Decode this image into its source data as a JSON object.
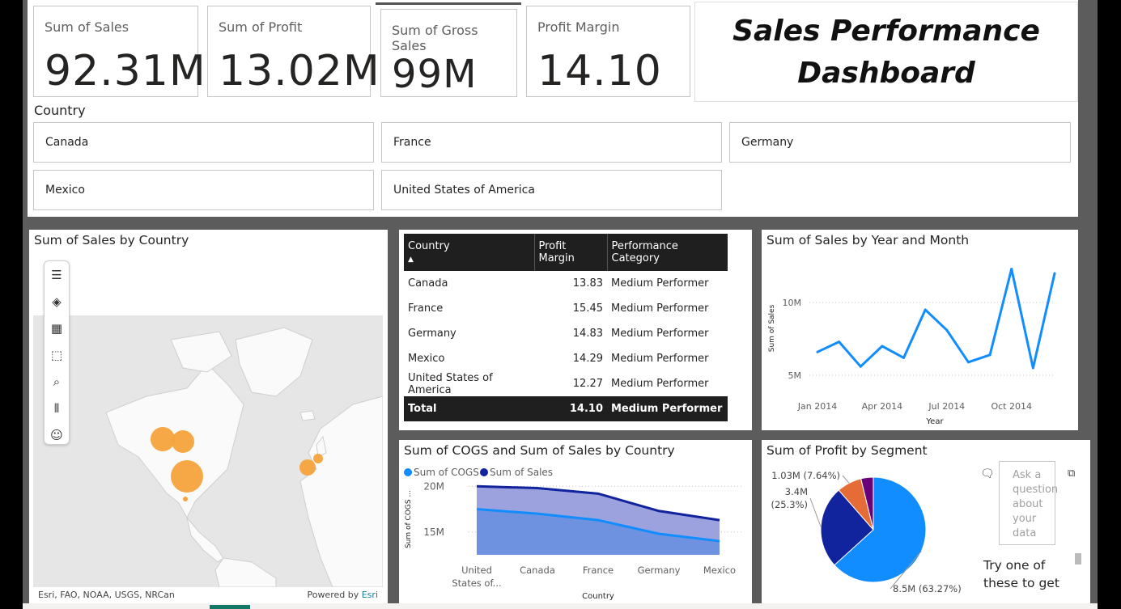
{
  "kpis": {
    "sales": {
      "label": "Sum of Sales",
      "value": "92.31M"
    },
    "profit": {
      "label": "Sum of Profit",
      "value": "13.02M"
    },
    "gross": {
      "label": "Sum of Gross Sales",
      "value": "99M"
    },
    "margin": {
      "label": "Profit Margin",
      "value": "14.10"
    }
  },
  "title": {
    "line1": "Sales Performance",
    "line2": "Dashboard"
  },
  "slicer": {
    "title": "Country",
    "options": [
      "Canada",
      "France",
      "Germany",
      "Mexico",
      "United States of America"
    ]
  },
  "map_panel": {
    "title": "Sum of Sales by Country",
    "attribution": "Esri, FAO, NOAA, USGS, NRCan",
    "powered": "Powered by",
    "esri": "Esri",
    "tools": [
      "menu-icon",
      "layers-icon",
      "qr-icon",
      "select-icon",
      "search-icon",
      "bars-icon",
      "person-icon"
    ]
  },
  "table": {
    "headers": [
      "Country",
      "Profit Margin",
      "Performance Category"
    ],
    "rows": [
      {
        "country": "Canada",
        "margin": "13.83",
        "category": "Medium Performer"
      },
      {
        "country": "France",
        "margin": "15.45",
        "category": "Medium Performer"
      },
      {
        "country": "Germany",
        "margin": "14.83",
        "category": "Medium Performer"
      },
      {
        "country": "Mexico",
        "margin": "14.29",
        "category": "Medium Performer"
      },
      {
        "country": "United States of America",
        "margin": "12.27",
        "category": "Medium Performer"
      }
    ],
    "total": {
      "label": "Total",
      "margin": "14.10",
      "category": "Medium Performer"
    }
  },
  "qa": {
    "placeholder": "Ask a question about your data",
    "try": "Try one of these to get"
  },
  "colors": {
    "blue": "#118dff",
    "darkblue": "#12239e",
    "orange": "#e66c37",
    "purple": "#6b007b",
    "bubble": "#f5a33c"
  },
  "chart_data": [
    {
      "type": "line",
      "title": "Sum of Sales by Year and Month",
      "xlabel": "Year",
      "ylabel": "Sum of Sales",
      "x": [
        "Jan 2014",
        "Feb 2014",
        "Mar 2014",
        "Apr 2014",
        "May 2014",
        "Jun 2014",
        "Jul 2014",
        "Aug 2014",
        "Sep 2014",
        "Oct 2014",
        "Nov 2014",
        "Dec 2014"
      ],
      "x_ticks": [
        "Jan 2014",
        "Apr 2014",
        "Jul 2014",
        "Oct 2014"
      ],
      "y_ticks": [
        "5M",
        "10M"
      ],
      "values": [
        6.6,
        7.3,
        5.6,
        7.0,
        6.2,
        9.5,
        8.1,
        5.9,
        6.4,
        12.3,
        5.5,
        12.0
      ],
      "ylim": [
        4,
        13
      ]
    },
    {
      "type": "area",
      "title": "Sum of COGS and Sum of Sales by Country",
      "xlabel": "Country",
      "ylabel": "Sum of COGS ...",
      "categories": [
        "United States of...",
        "Canada",
        "France",
        "Germany",
        "Mexico"
      ],
      "y_ticks": [
        "15M",
        "20M"
      ],
      "series": [
        {
          "name": "Sum of COGS",
          "values": [
            17.5,
            17.0,
            16.3,
            14.8,
            14.0
          ]
        },
        {
          "name": "Sum of  Sales",
          "values": [
            20.0,
            19.8,
            19.2,
            17.3,
            16.3
          ]
        }
      ],
      "ylim": [
        12.5,
        21
      ]
    },
    {
      "type": "pie",
      "title": "Sum of Profit by Segment",
      "labels": [
        "8.5M (63.27%)",
        "3.4M (25.3%)",
        "1.03M (7.64%)",
        ""
      ],
      "values": [
        63.27,
        25.3,
        7.64,
        3.79
      ]
    }
  ]
}
